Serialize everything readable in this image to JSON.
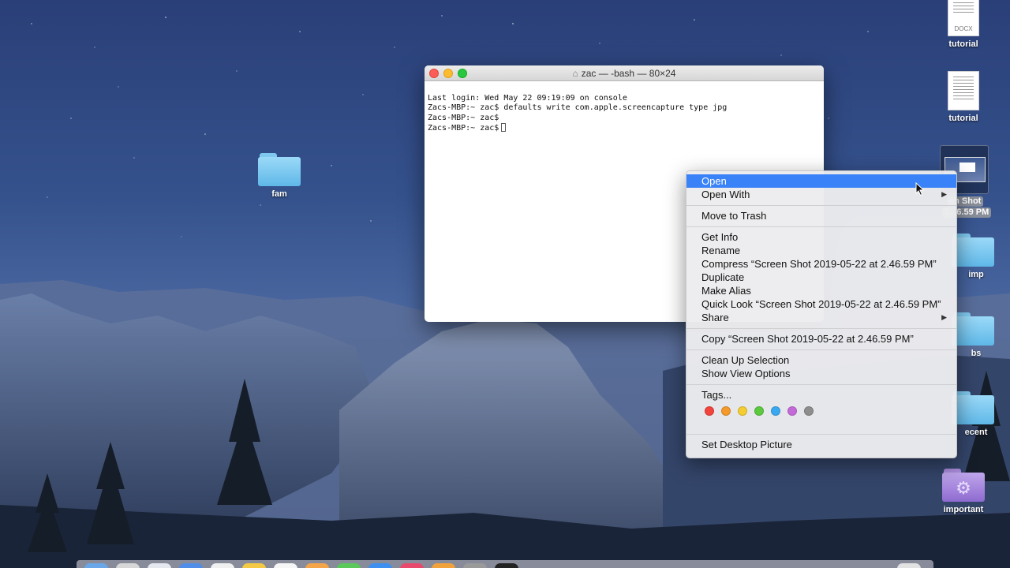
{
  "terminal": {
    "title": "zac — -bash — 80×24",
    "lines": [
      "Last login: Wed May 22 09:19:09 on console",
      "Zacs-MBP:~ zac$ defaults write com.apple.screencapture type jpg",
      "Zacs-MBP:~ zac$",
      "Zacs-MBP:~ zac$"
    ]
  },
  "desktop": {
    "icons": {
      "fam": "fam",
      "tutorial_docx": "tutorial",
      "tutorial_doc2": "tutorial",
      "screenshot_line1": "en Shot",
      "screenshot_line2": "5...6.59 PM",
      "imp": "imp",
      "bs": "bs",
      "recent": "ecent",
      "important": "important"
    },
    "docx_ext": "DOCX"
  },
  "context_menu": {
    "open": "Open",
    "open_with": "Open With",
    "move_to_trash": "Move to Trash",
    "get_info": "Get Info",
    "rename": "Rename",
    "compress": "Compress “Screen Shot 2019-05-22 at 2.46.59 PM”",
    "duplicate": "Duplicate",
    "make_alias": "Make Alias",
    "quick_look": "Quick Look “Screen Shot 2019-05-22 at 2.46.59 PM”",
    "share": "Share",
    "copy": "Copy “Screen Shot 2019-05-22 at 2.46.59 PM”",
    "clean_up": "Clean Up Selection",
    "show_view_options": "Show View Options",
    "tags": "Tags...",
    "set_desktop_picture": "Set Desktop Picture",
    "tag_colors": [
      "#f2433c",
      "#f39a2b",
      "#f4cd32",
      "#5cc93f",
      "#3aa8f0",
      "#c46ad8",
      "#8e8e8e"
    ]
  },
  "colors": {
    "menu_highlight": "#3a82f7",
    "folder_blue": "#6cc2ef",
    "folder_purple": "#a98ad9"
  }
}
